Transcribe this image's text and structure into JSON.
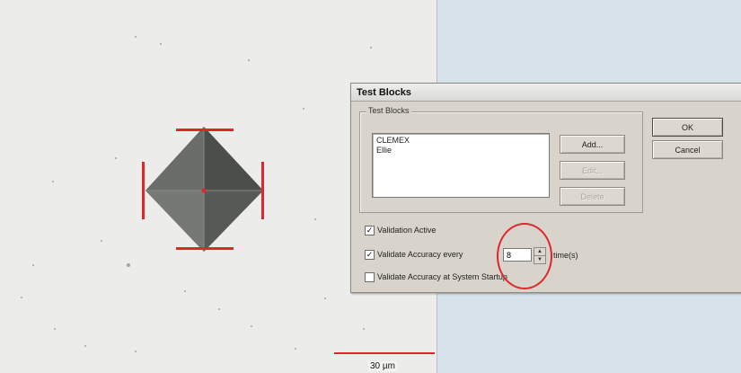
{
  "microscope": {
    "scale_label": "30 µm"
  },
  "dialog": {
    "title": "Test Blocks",
    "group_label": "Test Blocks",
    "list_items": [
      "CLEMEX",
      "Ellie"
    ],
    "buttons": {
      "add": "Add...",
      "edit": "Edit...",
      "delete": "Delete",
      "ok": "OK",
      "cancel": "Cancel"
    },
    "options": {
      "validation_active": {
        "label": "Validation Active",
        "checked": true
      },
      "validate_every": {
        "label": "Validate Accuracy every",
        "checked": true,
        "value": "8",
        "suffix": "time(s)"
      },
      "validate_startup": {
        "label": "Validate Accuracy at System Startup",
        "checked": false
      }
    }
  },
  "colors": {
    "highlight": "#e0262b",
    "dialog_bg": "#d8d4cb"
  }
}
